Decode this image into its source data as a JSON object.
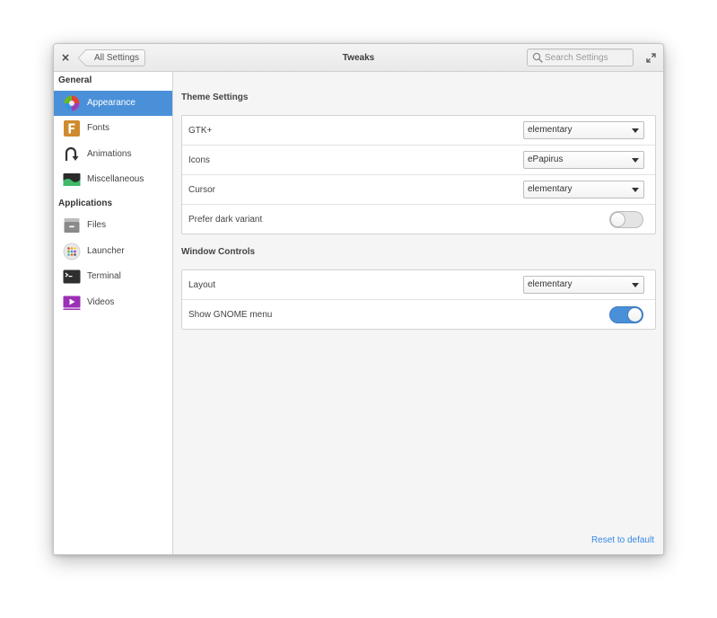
{
  "titlebar": {
    "close_glyph": "×",
    "back_label": "All Settings",
    "title": "Tweaks",
    "search_placeholder": "Search Settings"
  },
  "sidebar": {
    "general_header": "General",
    "applications_header": "Applications",
    "general_items": [
      {
        "label": "Appearance",
        "icon": "appearance-icon",
        "selected": true
      },
      {
        "label": "Fonts",
        "icon": "fonts-icon"
      },
      {
        "label": "Animations",
        "icon": "animations-icon"
      },
      {
        "label": "Miscellaneous",
        "icon": "miscellaneous-icon"
      }
    ],
    "application_items": [
      {
        "label": "Files",
        "icon": "files-icon"
      },
      {
        "label": "Launcher",
        "icon": "launcher-icon"
      },
      {
        "label": "Terminal",
        "icon": "terminal-icon"
      },
      {
        "label": "Videos",
        "icon": "videos-icon"
      }
    ]
  },
  "theme_settings": {
    "title": "Theme Settings",
    "gtk_label": "GTK+",
    "gtk_value": "elementary",
    "icons_label": "Icons",
    "icons_value": "ePapirus",
    "cursor_label": "Cursor",
    "cursor_value": "elementary",
    "dark_label": "Prefer dark variant",
    "dark_enabled": false
  },
  "window_controls": {
    "title": "Window Controls",
    "layout_label": "Layout",
    "layout_value": "elementary",
    "gnome_menu_label": "Show GNOME menu",
    "gnome_menu_enabled": true
  },
  "footer": {
    "reset_label": "Reset to default"
  },
  "colors": {
    "accent": "#4a90d9",
    "link": "#3689e6"
  }
}
